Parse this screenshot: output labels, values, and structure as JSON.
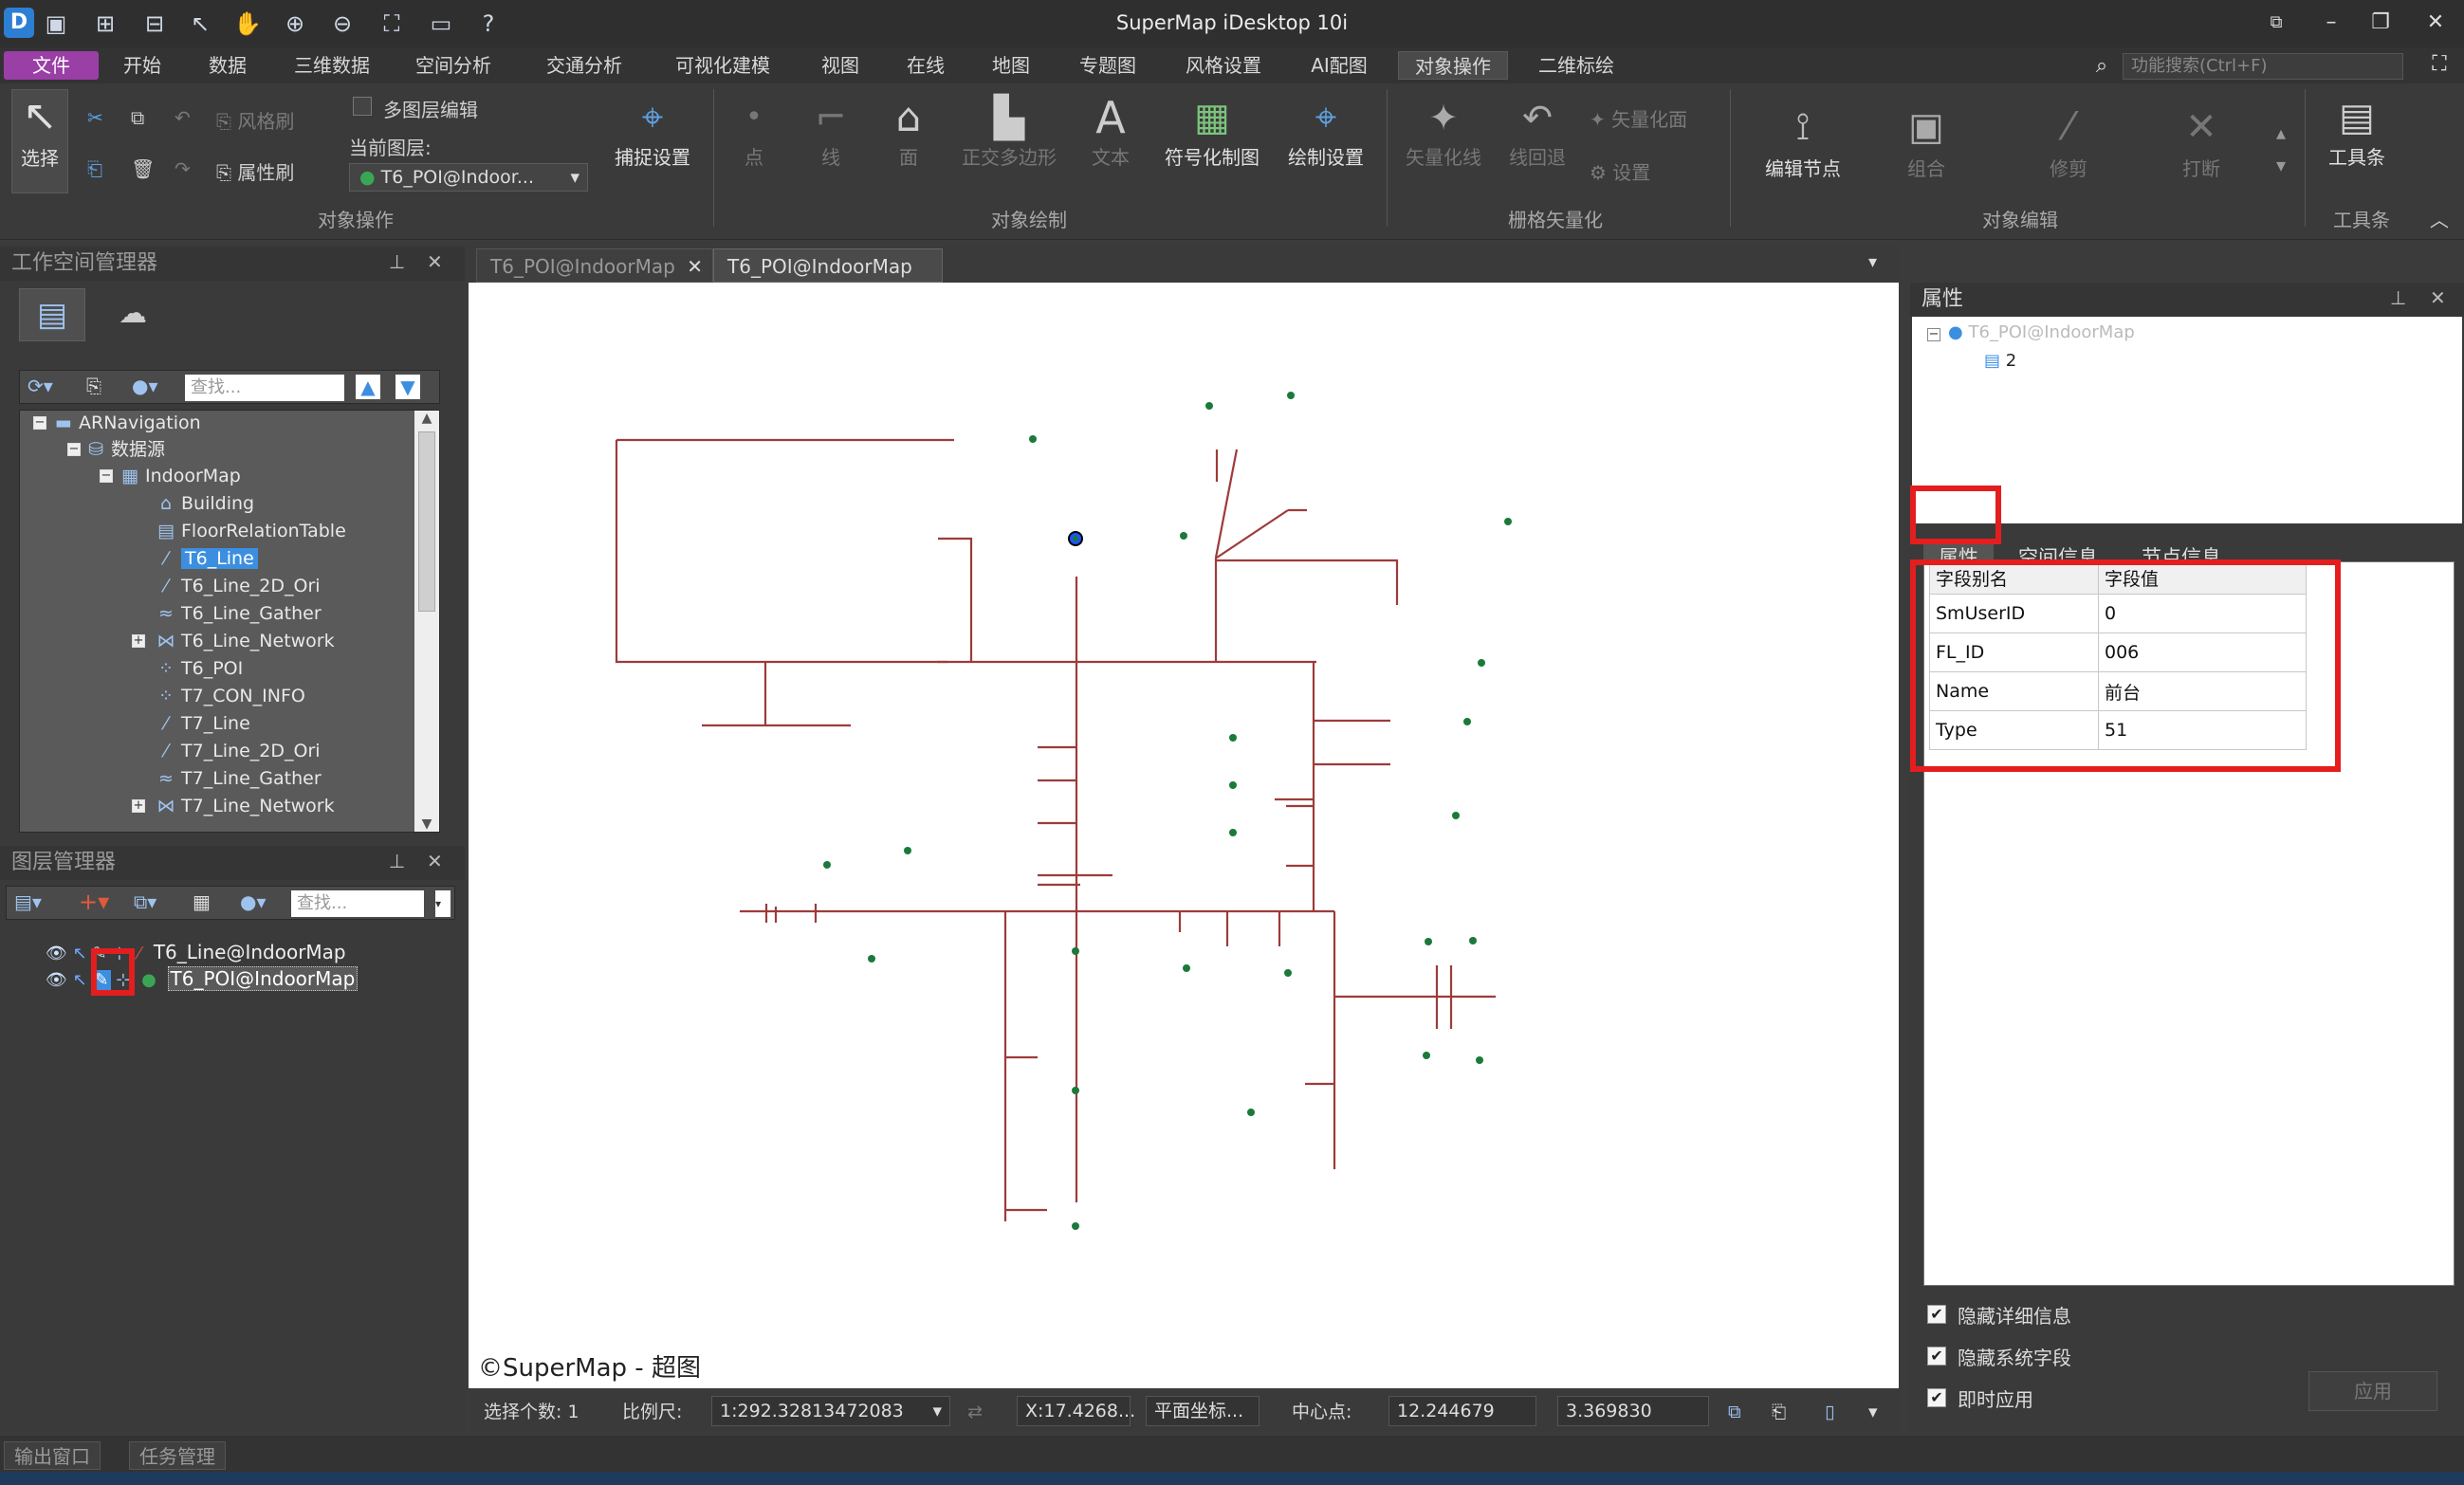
{
  "window": {
    "title": "SuperMap iDesktop 10i"
  },
  "menu": {
    "file": "文件",
    "tabs": [
      "开始",
      "数据",
      "三维数据",
      "空间分析",
      "交通分析",
      "可视化建模",
      "视图",
      "在线",
      "地图",
      "专题图",
      "风格设置",
      "AI配图",
      "对象操作",
      "二维标绘"
    ],
    "active_tab": "对象操作",
    "search_placeholder": "功能搜索(Ctrl+F)"
  },
  "ribbon": {
    "select": "选择",
    "style_brush": "风格刷",
    "attr_brush": "属性刷",
    "multi_layer_edit": "多图层编辑",
    "current_layer_label": "当前图层:",
    "current_layer_value": "T6_POI@Indoor...",
    "snap_settings": "捕捉设置",
    "group_object_ops": "对象操作",
    "draw_point": "点",
    "draw_line": "线",
    "draw_region": "面",
    "draw_ortho_polygon": "正交多边形",
    "draw_text": "文本",
    "symbol_drawing": "符号化制图",
    "draw_settings": "绘制设置",
    "group_object_draw": "对象绘制",
    "vectorize_line": "矢量化线",
    "line_rollback": "线回退",
    "vectorize_region": "矢量化面",
    "vectorize_settings": "设置",
    "group_raster_vector": "栅格矢量化",
    "edit_nodes": "编辑节点",
    "combine": "组合",
    "trim": "修剪",
    "break": "打断",
    "group_object_edit": "对象编辑",
    "toolbar": "工具条",
    "group_toolbar": "工具条"
  },
  "workspace": {
    "title": "工作空间管理器",
    "search_placeholder": "查找...",
    "tree": [
      "ARNavigation",
      "数据源",
      "IndoorMap",
      "Building",
      "FloorRelationTable",
      "T6_Line",
      "T6_Line_2D_Ori",
      "T6_Line_Gather",
      "T6_Line_Network",
      "T6_POI",
      "T7_CON_INFO",
      "T7_Line",
      "T7_Line_2D_Ori",
      "T7_Line_Gather",
      "T7_Line_Network"
    ],
    "selected": "T6_Line"
  },
  "layers": {
    "title": "图层管理器",
    "search_placeholder": "查找...",
    "items": [
      "T6_Line@IndoorMap",
      "T6_POI@IndoorMap"
    ]
  },
  "map": {
    "tabs": [
      "T6_POI@IndoorMap",
      "T6_POI@IndoorMap"
    ],
    "copyright": "©SuperMap - 超图",
    "line_color": "#9e3b3b",
    "point_color": "#1b7a3a"
  },
  "status": {
    "selected_count": "选择个数: 1",
    "scale_label": "比例尺:",
    "scale_value": "1:292.32813472083",
    "coord": "X:17.4268...",
    "coord_system": "平面坐标...",
    "center_label": "中心点:",
    "center_x": "12.244679",
    "center_y": "3.369830"
  },
  "properties": {
    "title": "属性",
    "tree_root": "T6_POI@IndoorMap",
    "tree_child": "2",
    "tabs": [
      "属性",
      "空间信息",
      "节点信息"
    ],
    "table_headers": [
      "字段别名",
      "字段值"
    ],
    "rows": [
      {
        "field": "SmUserID",
        "value": "0"
      },
      {
        "field": "FL_ID",
        "value": "006"
      },
      {
        "field": "Name",
        "value": "前台"
      },
      {
        "field": "Type",
        "value": "51"
      }
    ],
    "options": [
      "隐藏详细信息",
      "隐藏系统字段",
      "即时应用"
    ],
    "apply": "应用"
  },
  "bottom": {
    "tabs": [
      "输出窗口",
      "任务管理"
    ]
  }
}
